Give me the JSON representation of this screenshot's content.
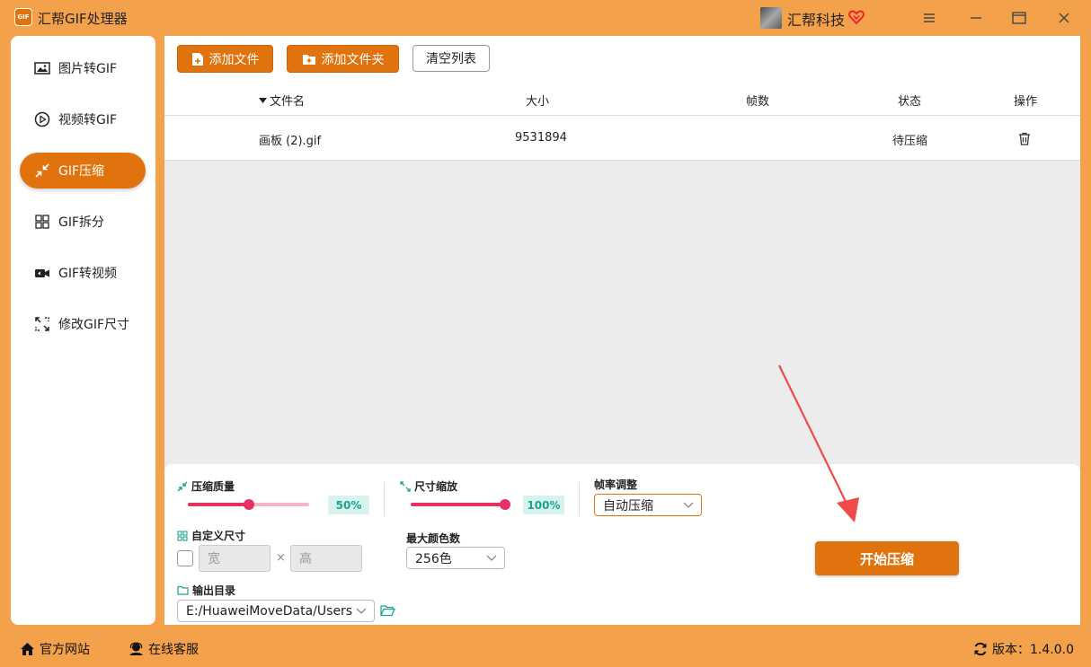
{
  "window": {
    "logo_text": "GIF",
    "title": "汇帮GIF处理器",
    "user_name": "汇帮科技"
  },
  "sidebar": {
    "items": [
      {
        "label": "图片转GIF",
        "icon": "image-icon"
      },
      {
        "label": "视频转GIF",
        "icon": "play-circle-icon"
      },
      {
        "label": "GIF压缩",
        "icon": "compress-icon",
        "active": true
      },
      {
        "label": "GIF拆分",
        "icon": "split-grid-icon"
      },
      {
        "label": "GIF转视频",
        "icon": "video-camera-icon"
      },
      {
        "label": "修改GIF尺寸",
        "icon": "resize-icon"
      }
    ]
  },
  "toolbar": {
    "add_file": "添加文件",
    "add_folder": "添加文件夹",
    "clear_list": "清空列表"
  },
  "table": {
    "columns": [
      "文件名",
      "大小",
      "帧数",
      "状态",
      "操作"
    ],
    "rows": [
      {
        "name": "画板 (2).gif",
        "size": "9531894",
        "frames": "",
        "status": "待压缩"
      }
    ]
  },
  "settings": {
    "quality_label": "压缩质量",
    "quality_value": "50%",
    "quality_fraction": 0.5,
    "scale_label": "尺寸缩放",
    "scale_value": "100%",
    "scale_fraction": 1.0,
    "framerate_label": "帧率调整",
    "framerate_value": "自动压缩",
    "custom_size_label": "自定义尺寸",
    "width_placeholder": "宽",
    "height_placeholder": "高",
    "times_sign": "×",
    "max_colors_label": "最大颜色数",
    "max_colors_value": "256色",
    "output_dir_label": "输出目录",
    "output_dir_value": "E:/HuaweiMoveData/Users"
  },
  "actions": {
    "start": "开始压缩"
  },
  "footer": {
    "website": "官方网站",
    "support": "在线客服",
    "version": "版本：1.4.0.0"
  },
  "colors": {
    "accent": "#e0730d",
    "background": "#f3a14a",
    "slider": "#e73064",
    "arrow": "#f04a4a"
  }
}
